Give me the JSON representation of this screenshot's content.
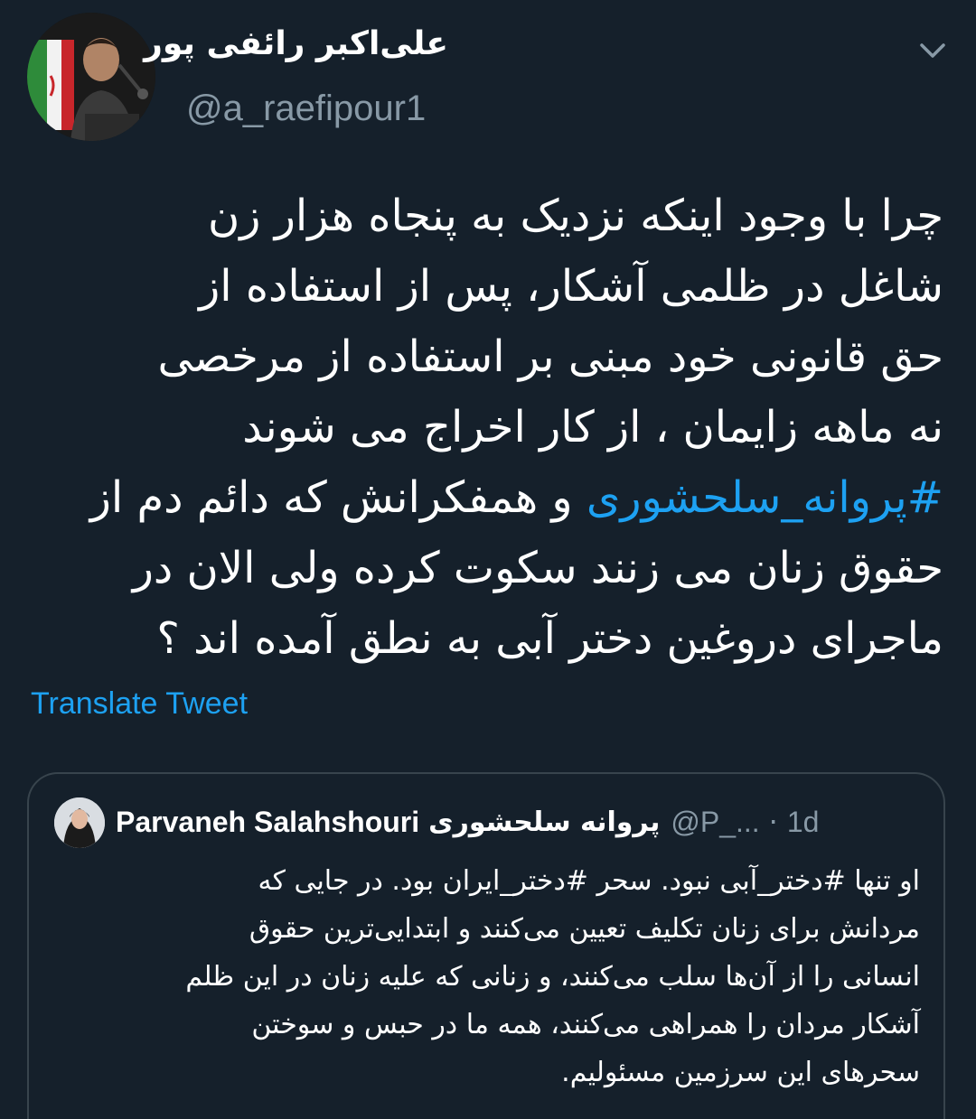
{
  "author": {
    "display_name": "علی‌اکبر رائفی پور",
    "handle": "@a_raefipour1"
  },
  "tweet": {
    "lines": [
      "چرا با وجود اینکه نزدیک به پنجاه هزار زن",
      "شاغل در ظلمی آشکار،  پس از استفاده از",
      "حق قانونی خود مبنی بر استفاده از مرخصی",
      "نه ماهه زایمان ، از کار اخراج می شوند"
    ],
    "hashtag": "#پروانه_سلحشوری",
    "line5_rest": " و همفکرانش که دائم دم از",
    "lines_after": [
      "حقوق زنان می زنند سکوت کرده ولی الان در",
      "ماجرای دروغین دختر آبی به نطق آمده اند ؟"
    ],
    "translate_label": "Translate Tweet"
  },
  "quoted": {
    "name": "Parvaneh Salahshouri",
    "name_fa": "پروانه سلحشوری",
    "handle": "@P_...",
    "dot": "·",
    "time": "1d",
    "lines": [
      "او تنها #دختر_آبی نبود. سحر #دختر_ایران بود. در جایی که",
      "مردانش برای زنان تکلیف تعیین می‌کنند و ابتدایی‌ترین حقوق",
      "انسانی را از آن‌ها سلب می‌کنند، و زنانی که علیه زنان در این ظلم",
      "آشکار مردان را همراهی می‌کنند، همه ما در حبس و سوختن",
      "سحرهای این سرزمین مسئولیم."
    ]
  },
  "icons": {
    "avatar": "avatar-photo",
    "caret": "chevron-down-icon",
    "quoted_avatar": "quoted-avatar-photo"
  },
  "colors": {
    "background": "#15202b",
    "accent": "#1da1f2",
    "secondary_text": "#8899a6",
    "border": "#38444d"
  }
}
